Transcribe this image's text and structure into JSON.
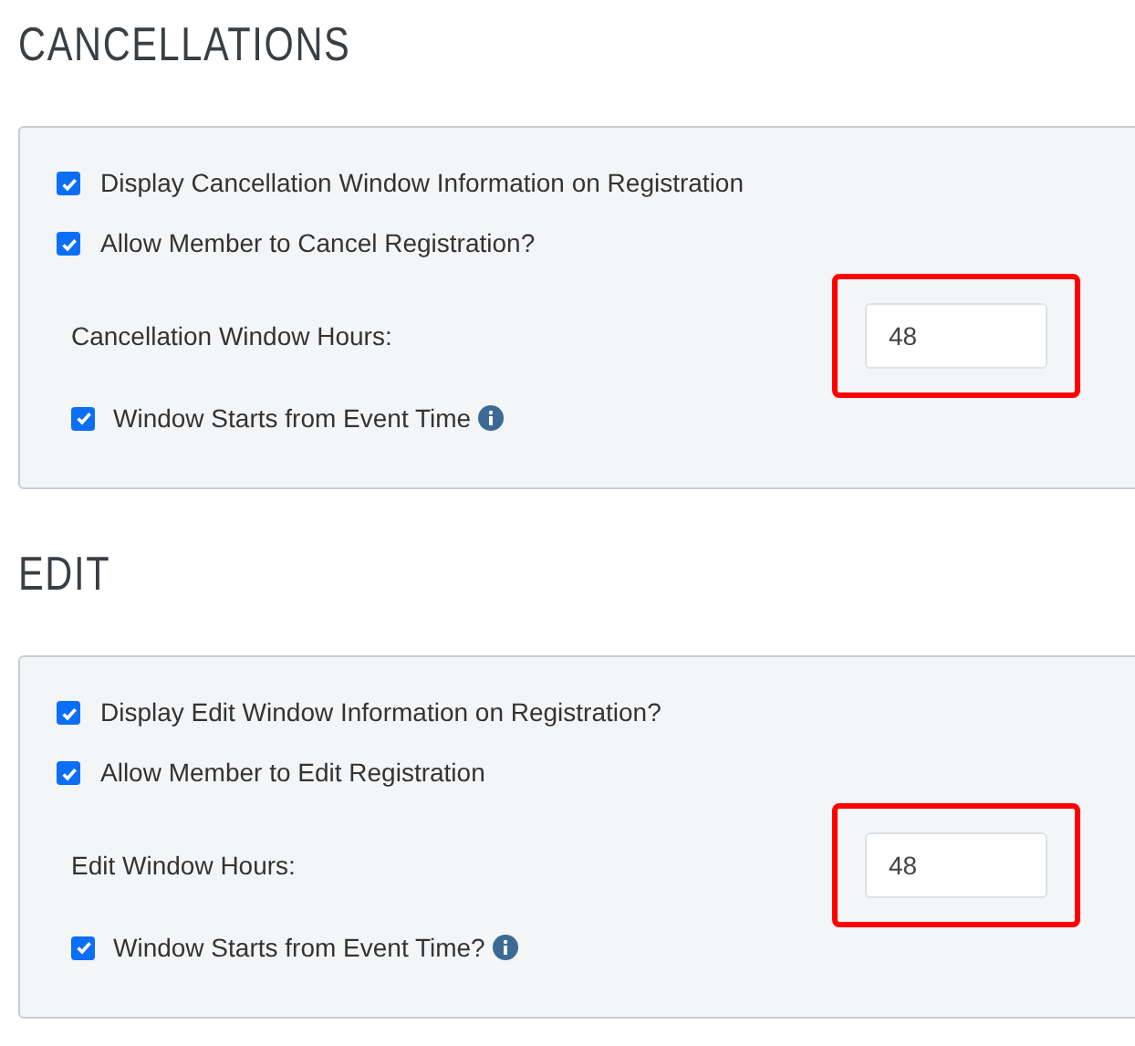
{
  "sections": [
    {
      "title": "CANCELLATIONS",
      "items": [
        {
          "kind": "checkbox",
          "label": "Display Cancellation Window Information on Registration",
          "checked": true
        },
        {
          "kind": "checkbox",
          "label": "Allow Member to Cancel Registration?",
          "checked": true
        },
        {
          "kind": "hours",
          "label": "Cancellation Window Hours:",
          "value": "48",
          "highlighted": true
        },
        {
          "kind": "sub-checkbox",
          "label": "Window Starts from Event Time",
          "checked": true,
          "info": true
        }
      ]
    },
    {
      "title": "EDIT",
      "items": [
        {
          "kind": "checkbox",
          "label": "Display Edit Window Information on Registration?",
          "checked": true
        },
        {
          "kind": "checkbox",
          "label": "Allow Member to Edit Registration",
          "checked": true
        },
        {
          "kind": "hours",
          "label": "Edit Window Hours:",
          "value": "48",
          "highlighted": true
        },
        {
          "kind": "sub-checkbox",
          "label": "Window Starts from Event Time?",
          "checked": true,
          "info": true
        }
      ]
    }
  ]
}
